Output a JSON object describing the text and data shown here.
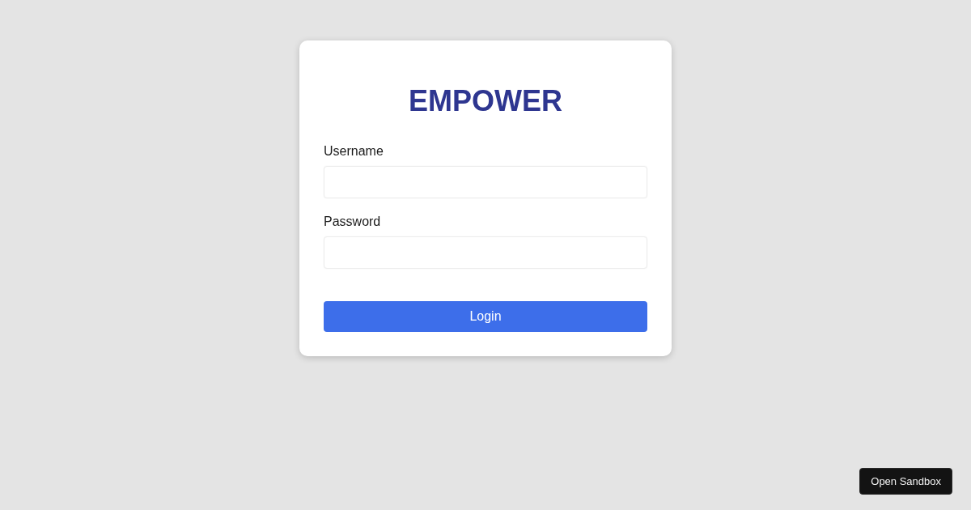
{
  "login_card": {
    "title": "EMPOWER",
    "fields": [
      {
        "label": "Username"
      },
      {
        "label": "Password"
      }
    ],
    "submit_button": "Login"
  },
  "sandbox_button": "Open Sandbox"
}
